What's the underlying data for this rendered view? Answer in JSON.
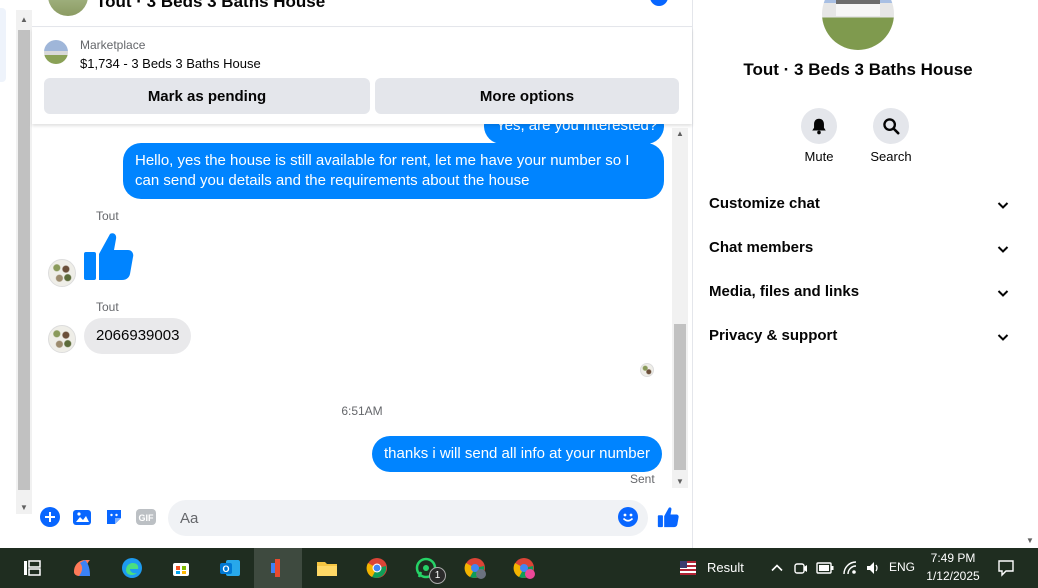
{
  "chat": {
    "header_title": "Tout · 3 Beds 3 Baths House",
    "marketplace_label": "Marketplace",
    "marketplace_item": "$1,734 - 3 Beds 3 Baths House",
    "mark_pending_label": "Mark as pending",
    "more_options_label": "More options",
    "messages": {
      "prev_out_partial": "Yes, are you interested?",
      "out_1": "Hello, yes the house is still available for rent, let me have your number so I can send you details and the requirements about the house",
      "sender_1": "Tout",
      "sender_2": "Tout",
      "in_number": "2066939003",
      "timestamp": "6:51AM",
      "out_2": "thanks i will send all info at your number",
      "status": "Sent"
    },
    "composer_placeholder": "Aa",
    "gif_label": "GIF"
  },
  "right_panel": {
    "title": "Tout · 3 Beds 3 Baths House",
    "mute_label": "Mute",
    "search_label": "Search",
    "sections": [
      "Customize chat",
      "Chat members",
      "Media, files and links",
      "Privacy & support"
    ]
  },
  "taskbar": {
    "weather_label": "Result",
    "lang": "ENG",
    "time": "7:49 PM",
    "date": "1/12/2025",
    "whatsapp_badge": "1"
  },
  "colors": {
    "accent": "#0084ff",
    "brand_blue": "#0866ff",
    "taskbar": "#1f2d20"
  }
}
